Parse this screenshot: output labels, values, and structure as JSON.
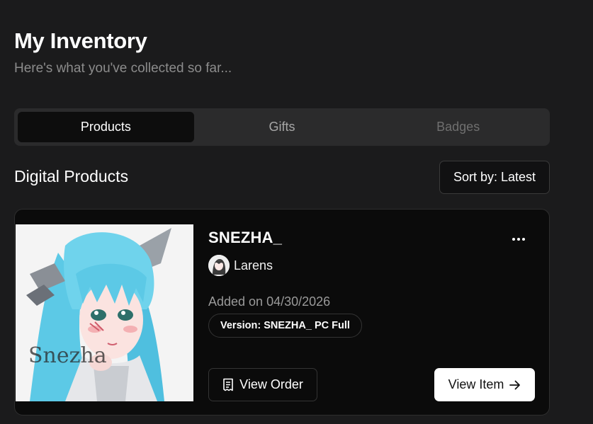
{
  "header": {
    "title": "My Inventory",
    "subtitle": "Here's what you've collected so far..."
  },
  "tabs": [
    {
      "label": "Products",
      "state": "active"
    },
    {
      "label": "Gifts",
      "state": "default"
    },
    {
      "label": "Badges",
      "state": "disabled"
    }
  ],
  "section": {
    "title": "Digital Products",
    "sort_label": "Sort by: Latest"
  },
  "card": {
    "product_name": "SNEZHA_",
    "creator_name": "Larens",
    "added_text": "Added on 04/30/2026",
    "version_text": "Version: SNEZHA_ PC Full",
    "view_order_label": "View Order",
    "view_item_label": "View Item",
    "thumbnail_watermark": "Snezha",
    "icons": {
      "more": "more-horizontal-icon",
      "order": "receipt-icon",
      "arrow": "arrow-right-icon"
    }
  },
  "colors": {
    "background": "#1b1b1c",
    "card": "#0b0b0b",
    "accent_hair": "#5cc9e6"
  }
}
